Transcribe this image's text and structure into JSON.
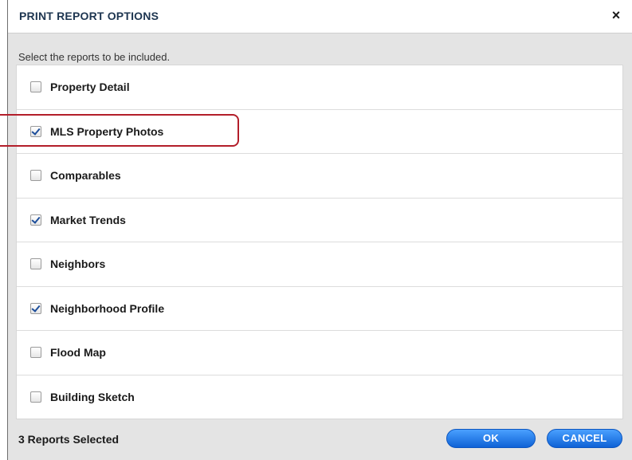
{
  "dialog": {
    "title": "PRINT REPORT OPTIONS",
    "close_glyph": "×",
    "instructions": "Select the reports to be included."
  },
  "reports": [
    {
      "label": "Property Detail",
      "checked": false
    },
    {
      "label": "MLS Property Photos",
      "checked": true
    },
    {
      "label": "Comparables",
      "checked": false
    },
    {
      "label": "Market Trends",
      "checked": true
    },
    {
      "label": "Neighbors",
      "checked": false
    },
    {
      "label": "Neighborhood Profile",
      "checked": true
    },
    {
      "label": "Flood Map",
      "checked": false
    },
    {
      "label": "Building Sketch",
      "checked": false
    }
  ],
  "footer": {
    "status": "3 Reports Selected",
    "ok_label": "OK",
    "cancel_label": "CANCEL"
  },
  "colors": {
    "title_text": "#1d3550",
    "button_blue": "#1a73e8",
    "highlight_red": "#b31e2a",
    "check_blue": "#1d4e9a"
  }
}
